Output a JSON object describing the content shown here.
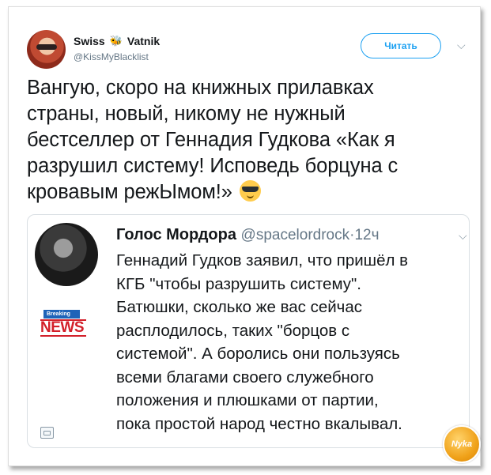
{
  "author": {
    "name_left": "Swiss",
    "name_right": "Vatnik",
    "handle": "@KissMyBlacklist"
  },
  "follow_label": "Читать",
  "tweet_lines": [
    "Вангую, скоро на книжных прилавках",
    "страны, новый, никому не нужный",
    "бестселлер от Геннадия Гудкова «Как я",
    "разрушил систему! Исповедь борцуна с",
    "кровавым режЫмом!»"
  ],
  "quoted": {
    "name": "Голос Мордора",
    "handle": "@spacelordrock",
    "separator": "·",
    "time": "12ч",
    "badge_top": "Breaking",
    "badge_bottom": "NEWS",
    "lines": [
      "Геннадий Гудков заявил, что пришёл в",
      "КГБ \"чтобы разрушить систему\".",
      "Батюшки, сколько же вас сейчас",
      "расплодилось, таких \"борцов с",
      "системой\". А боролись они пользуясь",
      "всеми благами своего служебного",
      "положения и плюшками от партии,",
      "пока простой народ честно вкалывал."
    ]
  },
  "watermark": "Nyka",
  "colors": {
    "accent": "#1da1f2",
    "muted": "#657786",
    "news_red": "#d3202a",
    "news_blue": "#1e63b8"
  }
}
